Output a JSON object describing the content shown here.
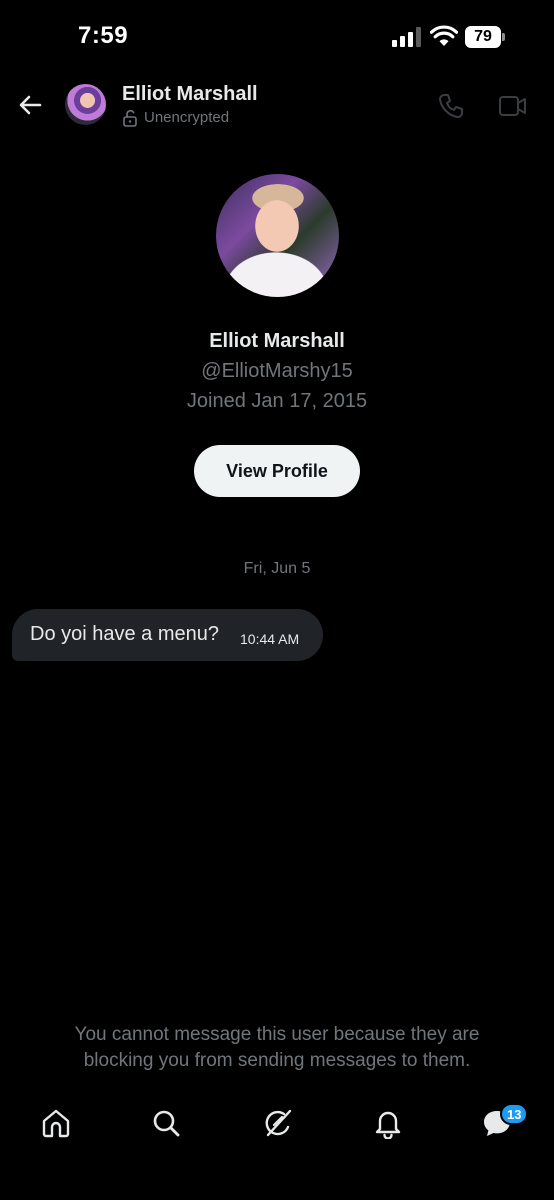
{
  "status_bar": {
    "time": "7:59",
    "battery_level": "79",
    "signal_bars_filled": 3,
    "signal_bars_total": 4
  },
  "header": {
    "name": "Elliot Marshall",
    "encryption_status": "Unencrypted",
    "icons": {
      "back": "arrow-left-icon",
      "lock": "unlock-icon",
      "call": "phone-icon",
      "video": "video-camera-icon"
    }
  },
  "profile": {
    "name": "Elliot Marshall",
    "handle": "@ElliotMarshy15",
    "joined": "Joined Jan 17, 2015",
    "view_profile_label": "View Profile"
  },
  "conversation": {
    "date_label": "Fri, Jun 5",
    "messages": [
      {
        "text": "Do yoi have a menu?",
        "time": "10:44 AM",
        "direction": "incoming"
      }
    ]
  },
  "blocked_notice": "You cannot message this user because they are blocking you from sending messages to them.",
  "bottom_nav": {
    "items": [
      {
        "name": "home",
        "icon": "home-icon"
      },
      {
        "name": "search",
        "icon": "search-icon"
      },
      {
        "name": "grok",
        "icon": "grok-icon"
      },
      {
        "name": "notifications",
        "icon": "bell-icon"
      },
      {
        "name": "messages",
        "icon": "messages-icon"
      }
    ],
    "messages_badge": "13"
  },
  "colors": {
    "background": "#000000",
    "primary_text": "#e7e9ea",
    "secondary_text": "#71767b",
    "bubble": "#202327",
    "badge": "#1d9bf0",
    "button_bg": "#eff3f4"
  }
}
